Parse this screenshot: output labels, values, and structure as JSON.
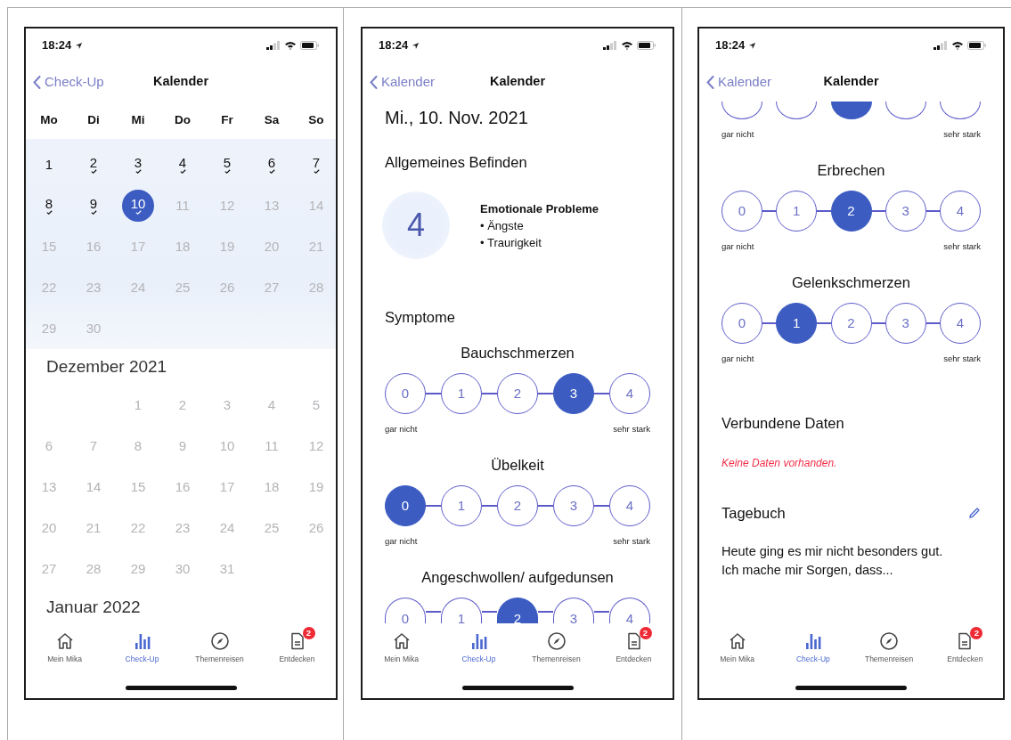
{
  "screens": [
    {
      "kind": "calendar",
      "status": {
        "time": "18:24"
      },
      "nav": {
        "back": "Check-Up",
        "title": "Kalender"
      },
      "weekdays": [
        "Mo",
        "Di",
        "Mi",
        "Do",
        "Fr",
        "Sa",
        "So"
      ],
      "months": [
        {
          "current": true,
          "weeks": [
            {
              "days": [
                {
                  "label": "1",
                  "checked": false,
                  "disabled": false,
                  "selected": false
                },
                {
                  "label": "2",
                  "checked": true,
                  "disabled": false,
                  "selected": false
                },
                {
                  "label": "3",
                  "checked": true,
                  "disabled": false,
                  "selected": false
                },
                {
                  "label": "4",
                  "checked": true,
                  "disabled": false,
                  "selected": false
                },
                {
                  "label": "5",
                  "checked": true,
                  "disabled": false,
                  "selected": false
                },
                {
                  "label": "6",
                  "checked": true,
                  "disabled": false,
                  "selected": false
                },
                {
                  "label": "7",
                  "checked": true,
                  "disabled": false,
                  "selected": false
                }
              ]
            },
            {
              "days": [
                {
                  "label": "8",
                  "checked": true,
                  "disabled": false,
                  "selected": false
                },
                {
                  "label": "9",
                  "checked": true,
                  "disabled": false,
                  "selected": false
                },
                {
                  "label": "10",
                  "checked": true,
                  "disabled": false,
                  "selected": true
                },
                {
                  "label": "11",
                  "checked": false,
                  "disabled": true,
                  "selected": false
                },
                {
                  "label": "12",
                  "checked": false,
                  "disabled": true,
                  "selected": false
                },
                {
                  "label": "13",
                  "checked": false,
                  "disabled": true,
                  "selected": false
                },
                {
                  "label": "14",
                  "checked": false,
                  "disabled": true,
                  "selected": false
                }
              ]
            },
            {
              "days": [
                {
                  "label": "15",
                  "checked": false,
                  "disabled": true,
                  "selected": false
                },
                {
                  "label": "16",
                  "checked": false,
                  "disabled": true,
                  "selected": false
                },
                {
                  "label": "17",
                  "checked": false,
                  "disabled": true,
                  "selected": false
                },
                {
                  "label": "18",
                  "checked": false,
                  "disabled": true,
                  "selected": false
                },
                {
                  "label": "19",
                  "checked": false,
                  "disabled": true,
                  "selected": false
                },
                {
                  "label": "20",
                  "checked": false,
                  "disabled": true,
                  "selected": false
                },
                {
                  "label": "21",
                  "checked": false,
                  "disabled": true,
                  "selected": false
                }
              ]
            },
            {
              "days": [
                {
                  "label": "22",
                  "checked": false,
                  "disabled": true,
                  "selected": false
                },
                {
                  "label": "23",
                  "checked": false,
                  "disabled": true,
                  "selected": false
                },
                {
                  "label": "24",
                  "checked": false,
                  "disabled": true,
                  "selected": false
                },
                {
                  "label": "25",
                  "checked": false,
                  "disabled": true,
                  "selected": false
                },
                {
                  "label": "26",
                  "checked": false,
                  "disabled": true,
                  "selected": false
                },
                {
                  "label": "27",
                  "checked": false,
                  "disabled": true,
                  "selected": false
                },
                {
                  "label": "28",
                  "checked": false,
                  "disabled": true,
                  "selected": false
                }
              ]
            },
            {
              "days": [
                {
                  "label": "29",
                  "checked": false,
                  "disabled": true,
                  "selected": false
                },
                {
                  "label": "30",
                  "checked": false,
                  "disabled": true,
                  "selected": false
                }
              ]
            }
          ]
        },
        {
          "title": "Dezember 2021",
          "current": false,
          "weeks": [
            {
              "align_end": true,
              "days": [
                {
                  "label": "1",
                  "checked": false,
                  "disabled": true,
                  "selected": false
                },
                {
                  "label": "2",
                  "checked": false,
                  "disabled": true,
                  "selected": false
                },
                {
                  "label": "3",
                  "checked": false,
                  "disabled": true,
                  "selected": false
                },
                {
                  "label": "4",
                  "checked": false,
                  "disabled": true,
                  "selected": false
                },
                {
                  "label": "5",
                  "checked": false,
                  "disabled": true,
                  "selected": false
                }
              ]
            },
            {
              "days": [
                {
                  "label": "6",
                  "checked": false,
                  "disabled": true,
                  "selected": false
                },
                {
                  "label": "7",
                  "checked": false,
                  "disabled": true,
                  "selected": false
                },
                {
                  "label": "8",
                  "checked": false,
                  "disabled": true,
                  "selected": false
                },
                {
                  "label": "9",
                  "checked": false,
                  "disabled": true,
                  "selected": false
                },
                {
                  "label": "10",
                  "checked": false,
                  "disabled": true,
                  "selected": false
                },
                {
                  "label": "11",
                  "checked": false,
                  "disabled": true,
                  "selected": false
                },
                {
                  "label": "12",
                  "checked": false,
                  "disabled": true,
                  "selected": false
                }
              ]
            },
            {
              "days": [
                {
                  "label": "13",
                  "checked": false,
                  "disabled": true,
                  "selected": false
                },
                {
                  "label": "14",
                  "checked": false,
                  "disabled": true,
                  "selected": false
                },
                {
                  "label": "15",
                  "checked": false,
                  "disabled": true,
                  "selected": false
                },
                {
                  "label": "16",
                  "checked": false,
                  "disabled": true,
                  "selected": false
                },
                {
                  "label": "17",
                  "checked": false,
                  "disabled": true,
                  "selected": false
                },
                {
                  "label": "18",
                  "checked": false,
                  "disabled": true,
                  "selected": false
                },
                {
                  "label": "19",
                  "checked": false,
                  "disabled": true,
                  "selected": false
                }
              ]
            },
            {
              "days": [
                {
                  "label": "20",
                  "checked": false,
                  "disabled": true,
                  "selected": false
                },
                {
                  "label": "21",
                  "checked": false,
                  "disabled": true,
                  "selected": false
                },
                {
                  "label": "22",
                  "checked": false,
                  "disabled": true,
                  "selected": false
                },
                {
                  "label": "23",
                  "checked": false,
                  "disabled": true,
                  "selected": false
                },
                {
                  "label": "24",
                  "checked": false,
                  "disabled": true,
                  "selected": false
                },
                {
                  "label": "25",
                  "checked": false,
                  "disabled": true,
                  "selected": false
                },
                {
                  "label": "26",
                  "checked": false,
                  "disabled": true,
                  "selected": false
                }
              ]
            },
            {
              "days": [
                {
                  "label": "27",
                  "checked": false,
                  "disabled": true,
                  "selected": false
                },
                {
                  "label": "28",
                  "checked": false,
                  "disabled": true,
                  "selected": false
                },
                {
                  "label": "29",
                  "checked": false,
                  "disabled": true,
                  "selected": false
                },
                {
                  "label": "30",
                  "checked": false,
                  "disabled": true,
                  "selected": false
                },
                {
                  "label": "31",
                  "checked": false,
                  "disabled": true,
                  "selected": false
                }
              ]
            }
          ]
        },
        {
          "title": "Januar 2022",
          "current": false
        }
      ],
      "tab_bar": [
        {
          "label": "Mein Mika",
          "selected": false
        },
        {
          "label": "Check-Up",
          "selected": true
        },
        {
          "label": "Themenreisen",
          "selected": false
        },
        {
          "label": "Entdecken",
          "selected": false,
          "badge": "2"
        }
      ]
    },
    {
      "kind": "entry",
      "status": {
        "time": "18:24"
      },
      "nav": {
        "back": "Kalender",
        "title": "Kalender"
      },
      "sections": [
        {
          "kind": "date",
          "text": "Mi., 10. Nov. 2021"
        },
        {
          "kind": "heading",
          "text": "Allgemeines Befinden"
        },
        {
          "kind": "wellbeing",
          "score": "4",
          "title": "Emotionale Probleme",
          "items": [
            "• Ängste",
            "• Traurigkeit"
          ]
        },
        {
          "kind": "heading",
          "text": "Symptome"
        },
        {
          "kind": "scale",
          "title": "Bauchschmerzen",
          "low": "gar nicht",
          "high": "sehr stark",
          "options": [
            {
              "label": "0",
              "selected": false
            },
            {
              "label": "1",
              "selected": false
            },
            {
              "label": "2",
              "selected": false
            },
            {
              "label": "3",
              "selected": true
            },
            {
              "label": "4",
              "selected": false
            }
          ]
        },
        {
          "kind": "scale",
          "title": "Übelkeit",
          "low": "gar nicht",
          "high": "sehr stark",
          "options": [
            {
              "label": "0",
              "selected": true
            },
            {
              "label": "1",
              "selected": false
            },
            {
              "label": "2",
              "selected": false
            },
            {
              "label": "3",
              "selected": false
            },
            {
              "label": "4",
              "selected": false
            }
          ]
        },
        {
          "kind": "scale",
          "title": "Angeschwollen/ aufgedunsen",
          "cut_bottom": true,
          "options": [
            {
              "label": "0",
              "selected": false
            },
            {
              "label": "1",
              "selected": false
            },
            {
              "label": "2",
              "selected": true
            },
            {
              "label": "3",
              "selected": false
            },
            {
              "label": "4",
              "selected": false
            }
          ]
        }
      ],
      "tab_bar": [
        {
          "label": "Mein Mika",
          "selected": false
        },
        {
          "label": "Check-Up",
          "selected": true
        },
        {
          "label": "Themenreisen",
          "selected": false
        },
        {
          "label": "Entdecken",
          "selected": false,
          "badge": "2"
        }
      ]
    },
    {
      "kind": "entry",
      "status": {
        "time": "18:24"
      },
      "nav": {
        "back": "Kalender",
        "title": "Kalender"
      },
      "sections": [
        {
          "kind": "scale",
          "cut_top": true,
          "low": "gar nicht",
          "high": "sehr stark",
          "options": [
            {
              "selected": false
            },
            {
              "selected": false
            },
            {
              "selected": true
            },
            {
              "selected": false
            },
            {
              "selected": false
            }
          ]
        },
        {
          "kind": "scale",
          "title": "Erbrechen",
          "low": "gar nicht",
          "high": "sehr stark",
          "options": [
            {
              "label": "0",
              "selected": false
            },
            {
              "label": "1",
              "selected": false
            },
            {
              "label": "2",
              "selected": true
            },
            {
              "label": "3",
              "selected": false
            },
            {
              "label": "4",
              "selected": false
            }
          ]
        },
        {
          "kind": "scale",
          "title": "Gelenkschmerzen",
          "low": "gar nicht",
          "high": "sehr stark",
          "options": [
            {
              "label": "0",
              "selected": false
            },
            {
              "label": "1",
              "selected": true
            },
            {
              "label": "2",
              "selected": false
            },
            {
              "label": "3",
              "selected": false
            },
            {
              "label": "4",
              "selected": false
            }
          ]
        },
        {
          "kind": "heading",
          "text": "Verbundene Daten"
        },
        {
          "kind": "notice",
          "text": "Keine Daten vorhanden."
        },
        {
          "kind": "heading",
          "text": "Tagebuch",
          "editable": true
        },
        {
          "kind": "text",
          "text": "Heute ging es mir nicht besonders gut. Ich mache mir Sorgen, dass..."
        }
      ],
      "tab_bar": [
        {
          "label": "Mein Mika",
          "selected": false
        },
        {
          "label": "Check-Up",
          "selected": true
        },
        {
          "label": "Themenreisen",
          "selected": false
        },
        {
          "label": "Entdecken",
          "selected": false,
          "badge": "2"
        }
      ]
    }
  ]
}
